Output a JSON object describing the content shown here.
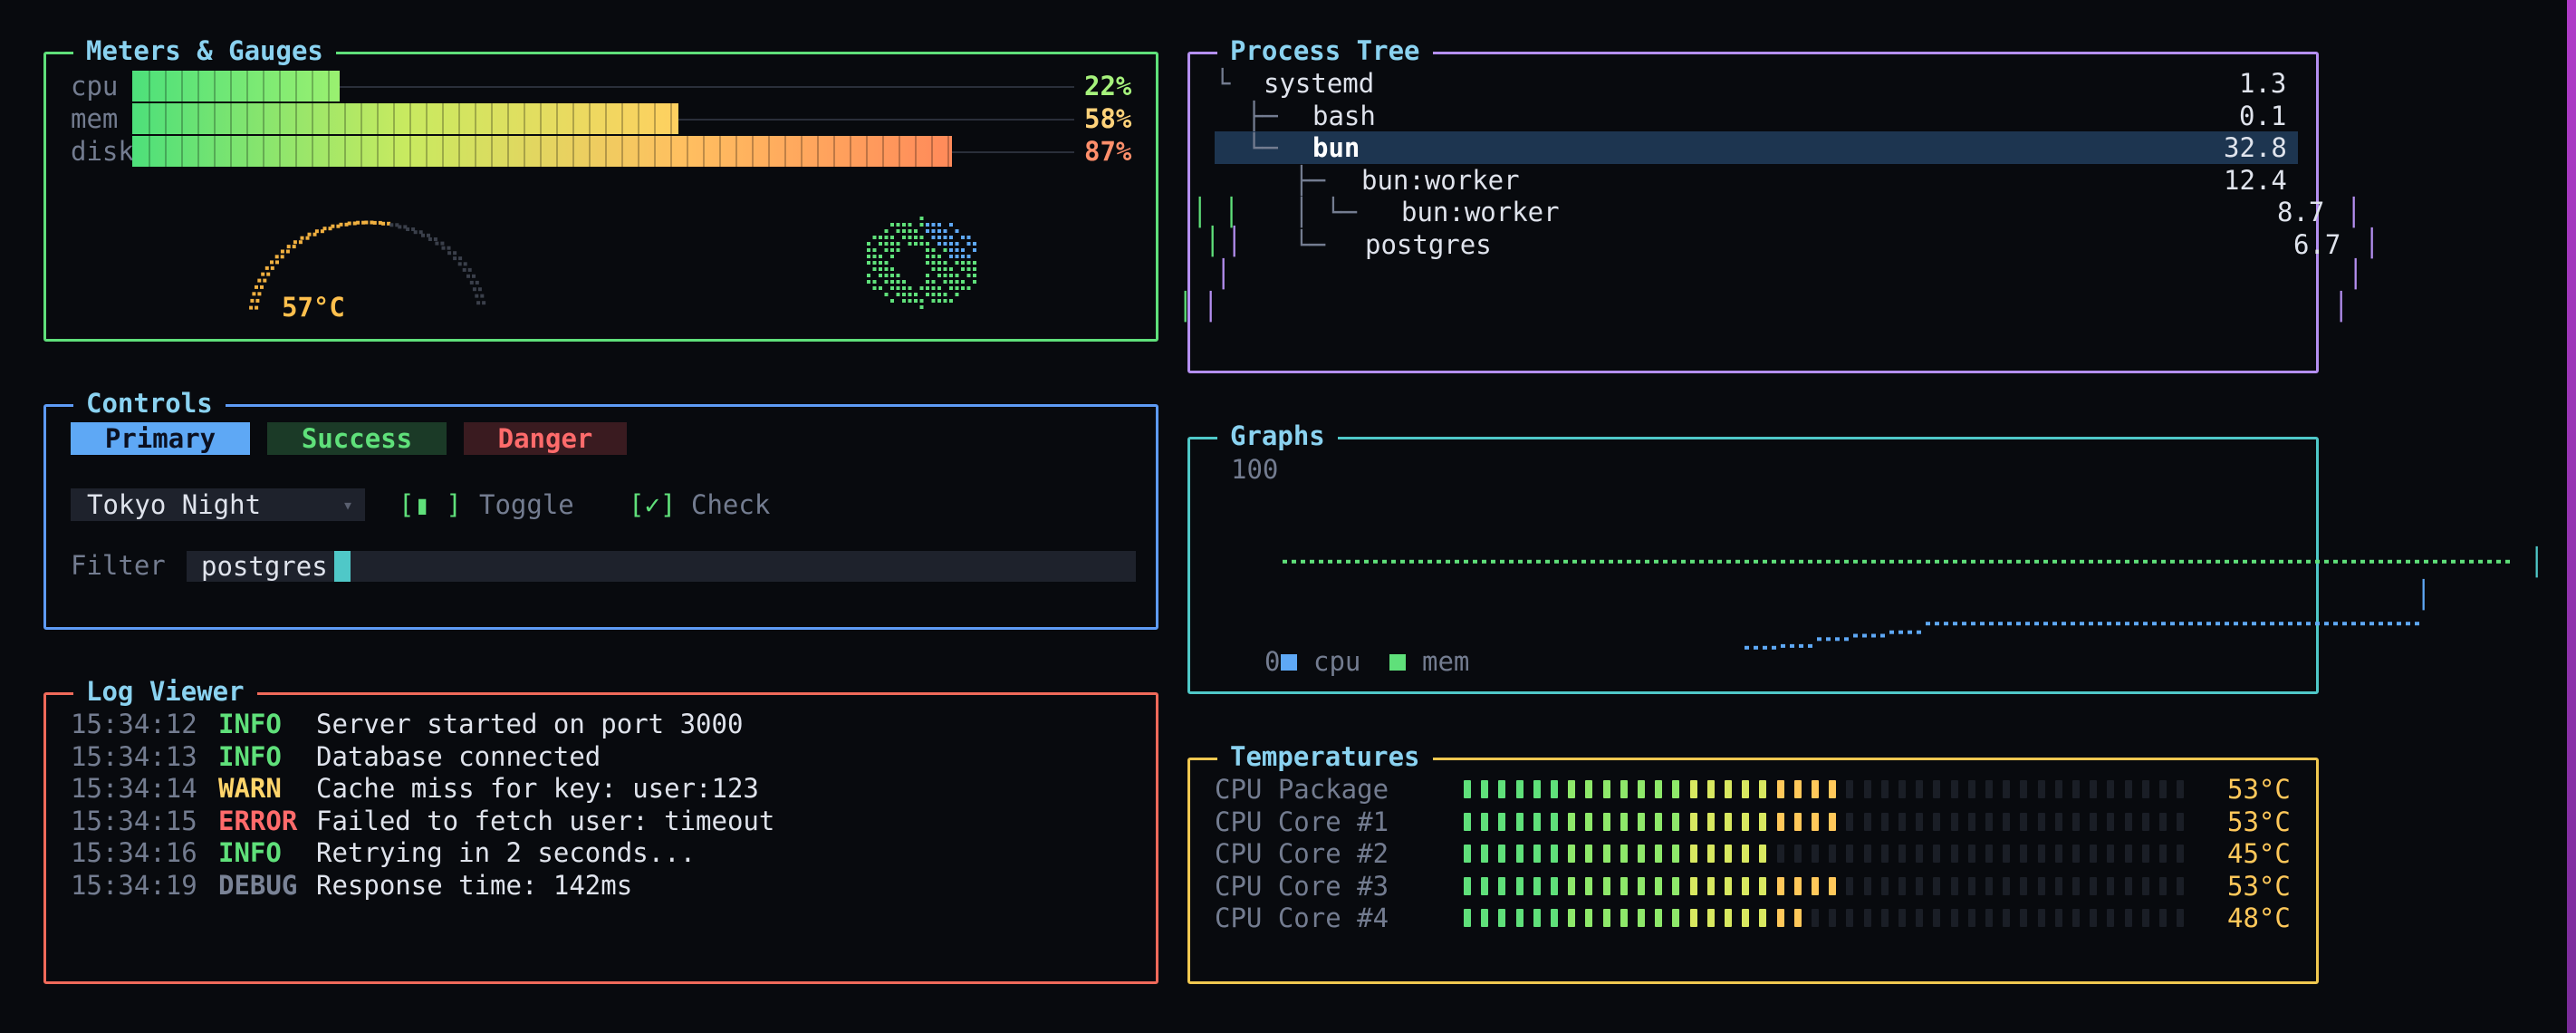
{
  "meters_panel": {
    "title": "Meters & Gauges",
    "meters": [
      {
        "label": "cpu",
        "value_text": "22%",
        "fraction": 0.22,
        "color": "#a6f27c"
      },
      {
        "label": "mem",
        "value_text": "58%",
        "fraction": 0.58,
        "color": "#ffd27a"
      },
      {
        "label": "disk",
        "value_text": "87%",
        "fraction": 0.87,
        "color": "#ff8f6b"
      }
    ],
    "gauge": {
      "label": "57°C",
      "level": 0.57,
      "color": "#f0b040"
    }
  },
  "process_panel": {
    "title": "Process Tree",
    "rows": [
      {
        "tree": "└ ",
        "name": "systemd",
        "value": "1.3",
        "selected": false
      },
      {
        "tree": "  ├─ ",
        "name": "bash",
        "value": "0.1",
        "selected": false
      },
      {
        "tree": "  └─ ",
        "name": "bun",
        "value": "32.8",
        "selected": true
      },
      {
        "tree": "     ├─ ",
        "name": "bun:worker",
        "value": "12.4",
        "selected": false
      },
      {
        "tree": "     │ └─ ",
        "name": "bun:worker",
        "value": "8.7",
        "selected": false
      },
      {
        "tree": "     └─ ",
        "name": "postgres",
        "value": "6.7",
        "selected": false
      }
    ]
  },
  "controls_panel": {
    "title": "Controls",
    "buttons": {
      "primary": "Primary",
      "success": "Success",
      "danger": "Danger"
    },
    "theme_select": {
      "value": "Tokyo Night",
      "arrow": "▾"
    },
    "toggle": {
      "glyph": "[▮ ]",
      "label": "Toggle"
    },
    "check": {
      "glyph": "[✓]",
      "label": "Check"
    },
    "filter": {
      "label": "Filter",
      "value": "postgres"
    }
  },
  "graphs_panel": {
    "title": "Graphs",
    "y_max": "100",
    "y_min": "0",
    "legend": [
      {
        "name": "cpu",
        "color": "#5ea8f5"
      },
      {
        "name": "mem",
        "color": "#5fe07a"
      }
    ]
  },
  "chart_data": {
    "type": "line",
    "ylim": [
      0,
      100
    ],
    "series": [
      {
        "name": "mem",
        "values": [
          58,
          58,
          58,
          58,
          58,
          58,
          58,
          58,
          58,
          58,
          58,
          58,
          58,
          58,
          58,
          58,
          58,
          58,
          58,
          58,
          58,
          58,
          58,
          58,
          58,
          58,
          58,
          58,
          58,
          58
        ]
      },
      {
        "name": "cpu",
        "values": [
          4,
          4,
          4,
          4,
          4,
          3,
          4,
          4,
          4,
          4,
          4,
          4,
          8,
          9,
          13,
          15,
          17,
          22,
          22,
          22,
          22,
          22,
          22,
          22,
          22,
          22,
          22,
          22,
          22,
          22
        ]
      }
    ]
  },
  "temps_panel": {
    "title": "Temperatures",
    "rows": [
      {
        "label": "CPU Package",
        "value_text": "53°C",
        "level": 0.53
      },
      {
        "label": "CPU Core #1",
        "value_text": "53°C",
        "level": 0.53
      },
      {
        "label": "CPU Core #2",
        "value_text": "45°C",
        "level": 0.45
      },
      {
        "label": "CPU Core #3",
        "value_text": "53°C",
        "level": 0.53
      },
      {
        "label": "CPU Core #4",
        "value_text": "48°C",
        "level": 0.48
      }
    ]
  },
  "log_panel": {
    "title": "Log Viewer",
    "entries": [
      {
        "time": "15:34:12",
        "level": "INFO",
        "message": "Server started on port 3000"
      },
      {
        "time": "15:34:13",
        "level": "INFO",
        "message": "Database connected"
      },
      {
        "time": "15:34:14",
        "level": "WARN",
        "message": "Cache miss for key: user:123"
      },
      {
        "time": "15:34:15",
        "level": "ERROR",
        "message": "Failed to fetch user: timeout"
      },
      {
        "time": "15:34:16",
        "level": "INFO",
        "message": "Retrying in 2 seconds..."
      },
      {
        "time": "15:34:19",
        "level": "DEBUG",
        "message": "Response time: 142ms"
      }
    ]
  },
  "colors": {
    "bg": "#080a0e",
    "title": "#8ad2f0",
    "border_meters": "#5fe07a",
    "border_process": "#b48ff0",
    "border_controls": "#5e9bf5",
    "border_graphs": "#4fc8c8",
    "border_temps": "#f0c850",
    "border_log": "#f06a5a",
    "level_info": "#5fe07a",
    "level_warn": "#ffd56b",
    "level_error": "#ff6b6b",
    "level_debug": "#7a8396"
  }
}
